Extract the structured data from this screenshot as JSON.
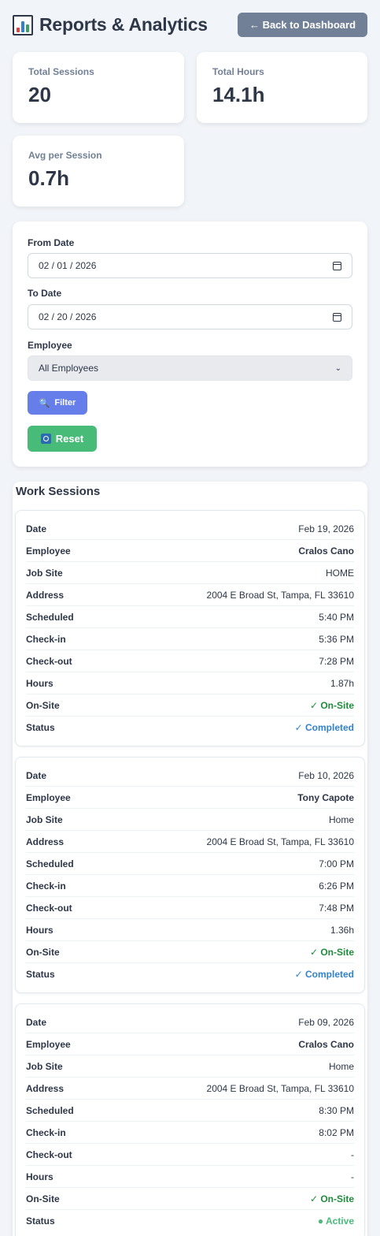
{
  "header": {
    "title": "Reports & Analytics",
    "icon": "bar-chart-icon",
    "back_button": "← Back to Dashboard"
  },
  "stats": [
    {
      "label": "Total Sessions",
      "value": "20"
    },
    {
      "label": "Total Hours",
      "value": "14.1h"
    },
    {
      "label": "Avg per Session",
      "value": "0.7h"
    }
  ],
  "filters": {
    "from_label": "From Date",
    "from_value": "02 / 01 / 2026",
    "to_label": "To Date",
    "to_value": "02 / 20 / 2026",
    "employee_label": "Employee",
    "employee_value": "All Employees",
    "filter_button": "Filter",
    "reset_button": "Reset"
  },
  "sessions_title": "Work Sessions",
  "labels": {
    "date": "Date",
    "employee": "Employee",
    "job_site": "Job Site",
    "address": "Address",
    "scheduled": "Scheduled",
    "check_in": "Check-in",
    "check_out": "Check-out",
    "hours": "Hours",
    "on_site": "On-Site",
    "status": "Status"
  },
  "sessions": [
    {
      "date": "Feb 19, 2026",
      "employee": "Cralos Cano",
      "job_site": "HOME",
      "address": "2004 E Broad St, Tampa, FL 33610",
      "scheduled": "5:40 PM",
      "check_in": "5:36 PM",
      "check_out": "7:28 PM",
      "hours": "1.87h",
      "on_site": "✓ On-Site",
      "status": "✓ Completed"
    },
    {
      "date": "Feb 10, 2026",
      "employee": "Tony Capote",
      "job_site": "Home",
      "address": "2004 E Broad St, Tampa, FL 33610",
      "scheduled": "7:00 PM",
      "check_in": "6:26 PM",
      "check_out": "7:48 PM",
      "hours": "1.36h",
      "on_site": "✓ On-Site",
      "status": "✓ Completed"
    },
    {
      "date": "Feb 09, 2026",
      "employee": "Cralos Cano",
      "job_site": "Home",
      "address": "2004 E Broad St, Tampa, FL 33610",
      "scheduled": "8:30 PM",
      "check_in": "8:02 PM",
      "check_out": "-",
      "hours": "-",
      "on_site": "✓ On-Site",
      "status": "● Active"
    }
  ],
  "colors": {
    "primary": "#667eea",
    "success": "#48bb78",
    "muted": "#718096",
    "completed": "#3182ce"
  }
}
